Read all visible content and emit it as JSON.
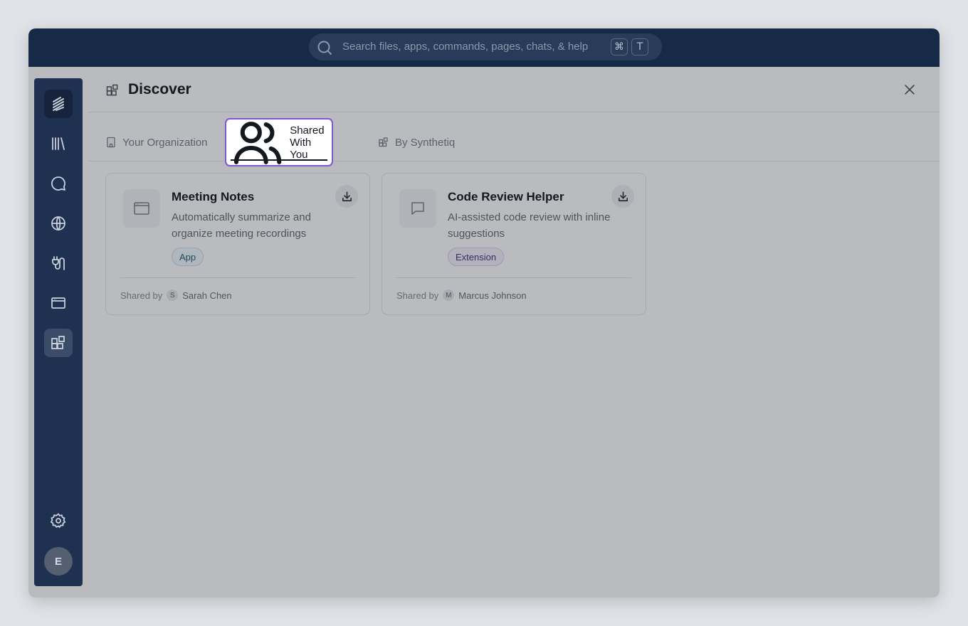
{
  "search": {
    "placeholder": "Search files, apps, commands, pages, chats, & help",
    "shortcut_mod": "⌘",
    "shortcut_key": "T"
  },
  "sidebar": {
    "items": [
      {
        "name": "logo",
        "icon": "stripes-logo-icon"
      },
      {
        "name": "library",
        "icon": "library-icon"
      },
      {
        "name": "chat",
        "icon": "chat-bubble-icon"
      },
      {
        "name": "web",
        "icon": "globe-icon"
      },
      {
        "name": "connectors",
        "icon": "plug-icon"
      },
      {
        "name": "apps",
        "icon": "browser-window-icon"
      },
      {
        "name": "discover",
        "icon": "blocks-icon",
        "active": true
      },
      {
        "name": "settings",
        "icon": "gear-icon"
      }
    ],
    "avatar_initial": "E"
  },
  "panel": {
    "title": "Discover",
    "title_icon": "blocks-icon"
  },
  "tabs": [
    {
      "label": "Your Organization",
      "icon": "building-icon",
      "active": false
    },
    {
      "label": "Shared With You",
      "icon": "users-icon",
      "active": true
    },
    {
      "label": "By Synthetiq",
      "icon": "blocks-icon",
      "active": false
    }
  ],
  "cards": [
    {
      "title": "Meeting Notes",
      "description": "Automatically summarize and organize meeting recordings",
      "badge": "App",
      "icon": "browser-window-icon",
      "shared_by_label": "Shared by",
      "sharer_initial": "S",
      "sharer_name": "Sarah Chen"
    },
    {
      "title": "Code Review Helper",
      "description": "AI-assisted code review with inline suggestions",
      "badge": "Extension",
      "icon": "chat-bubble-icon",
      "shared_by_label": "Shared by",
      "sharer_initial": "M",
      "sharer_name": "Marcus Johnson"
    }
  ],
  "colors": {
    "topbar": "#162947",
    "sidebar": "#1e3150",
    "active_tab_border": "#7f57d2",
    "overlay_bg": "#b9bbbf"
  }
}
